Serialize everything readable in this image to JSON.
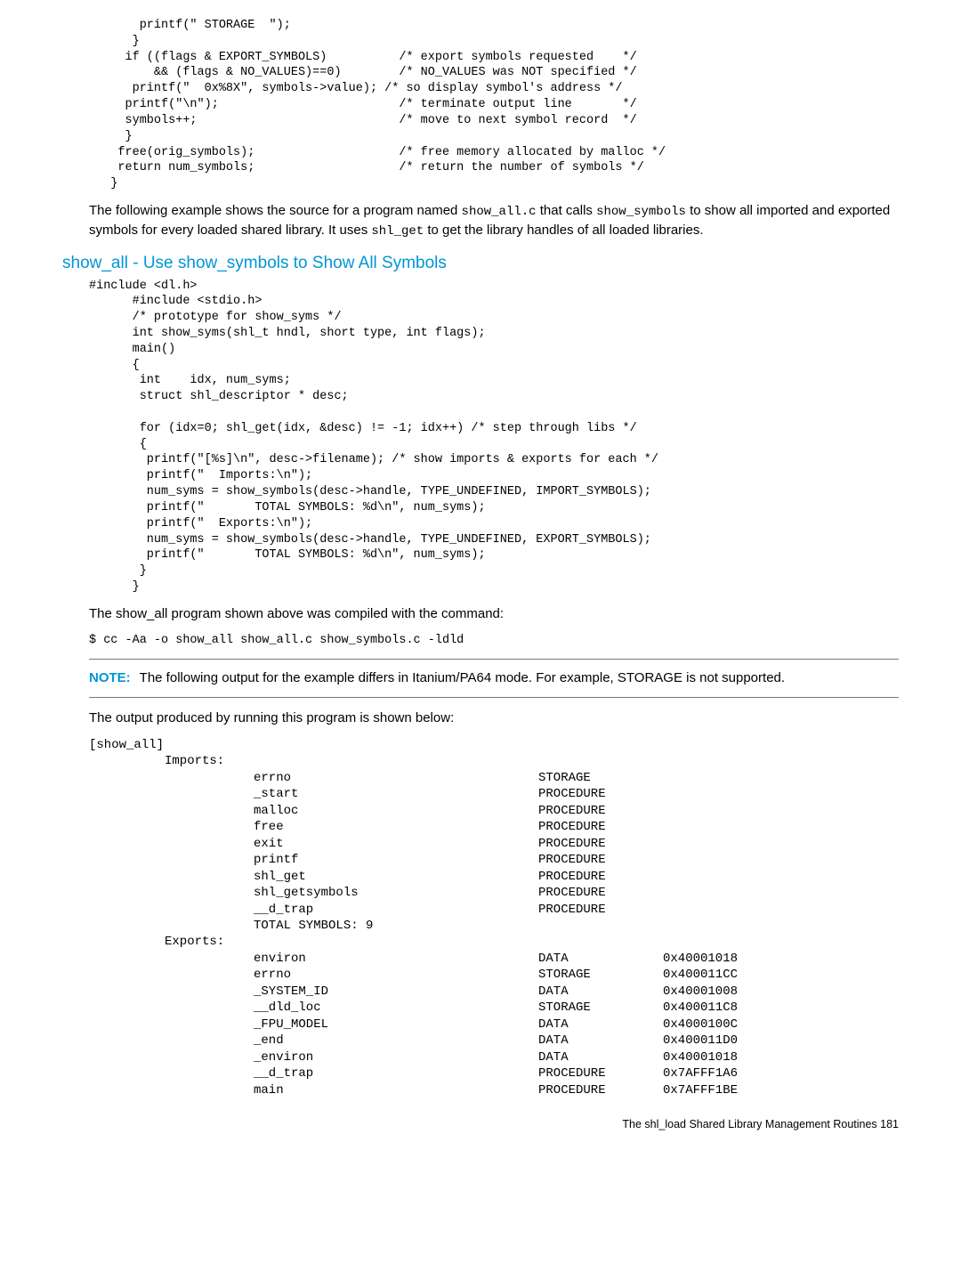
{
  "code1": "       printf(\" STORAGE  \");\n      }\n     if ((flags & EXPORT_SYMBOLS)          /* export symbols requested    */\n         && (flags & NO_VALUES)==0)        /* NO_VALUES was NOT specified */\n      printf(\"  0x%8X\", symbols->value); /* so display symbol's address */\n     printf(\"\\n\");                         /* terminate output line       */\n     symbols++;                            /* move to next symbol record  */\n     }\n    free(orig_symbols);                    /* free memory allocated by malloc */\n    return num_symbols;                    /* return the number of symbols */\n   }",
  "para1_a": "The following example shows the source for a program named ",
  "para1_m1": "show_all.c",
  "para1_b": " that calls ",
  "para1_m2": "show_symbols",
  "para1_c": " to show all imported and exported symbols for every loaded shared library. It uses ",
  "para1_m3": "shl_get",
  "para1_d": " to get the library handles of all loaded libraries.",
  "heading1": "show_all - Use show_symbols to Show All Symbols",
  "code2": "#include <dl.h>\n      #include <stdio.h>\n      /* prototype for show_syms */\n      int show_syms(shl_t hndl, short type, int flags);\n      main()\n      {\n       int    idx, num_syms;\n       struct shl_descriptor * desc;\n\n       for (idx=0; shl_get(idx, &desc) != -1; idx++) /* step through libs */\n       {\n        printf(\"[%s]\\n\", desc->filename); /* show imports & exports for each */\n        printf(\"  Imports:\\n\");\n        num_syms = show_symbols(desc->handle, TYPE_UNDEFINED, IMPORT_SYMBOLS);\n        printf(\"       TOTAL SYMBOLS: %d\\n\", num_syms);\n        printf(\"  Exports:\\n\");\n        num_syms = show_symbols(desc->handle, TYPE_UNDEFINED, EXPORT_SYMBOLS);\n        printf(\"       TOTAL SYMBOLS: %d\\n\", num_syms);\n       }\n      }",
  "para2": "The show_all program shown above was compiled with the command:",
  "cmd1": "$ cc -Aa -o show_all show_all.c show_symbols.c -ldld",
  "note_label": "NOTE:",
  "note_text": "The following output for the example differs in Itanium/PA64 mode. For example, STORAGE is not supported.",
  "para3": "The output produced by running this program is shown below:",
  "output_header": "[show_all]",
  "imports_label": "Imports:",
  "imports": [
    {
      "name": "errno",
      "type": "STORAGE"
    },
    {
      "name": "_start",
      "type": "PROCEDURE"
    },
    {
      "name": "malloc",
      "type": "PROCEDURE"
    },
    {
      "name": "free",
      "type": "PROCEDURE"
    },
    {
      "name": "exit",
      "type": "PROCEDURE"
    },
    {
      "name": "printf",
      "type": "PROCEDURE"
    },
    {
      "name": "shl_get",
      "type": "PROCEDURE"
    },
    {
      "name": "shl_getsymbols",
      "type": "PROCEDURE"
    },
    {
      "name": "__d_trap",
      "type": "PROCEDURE"
    }
  ],
  "total_symbols": "   TOTAL SYMBOLS: 9",
  "exports_label": "Exports:",
  "exports": [
    {
      "name": "environ",
      "type": "DATA",
      "addr": "0x40001018"
    },
    {
      "name": "errno",
      "type": "STORAGE",
      "addr": "0x400011CC"
    },
    {
      "name": "_SYSTEM_ID",
      "type": "DATA",
      "addr": "0x40001008"
    },
    {
      "name": "__dld_loc",
      "type": "STORAGE",
      "addr": "0x400011C8"
    },
    {
      "name": "_FPU_MODEL",
      "type": "DATA",
      "addr": "0x4000100C"
    },
    {
      "name": "_end",
      "type": "DATA",
      "addr": "0x400011D0"
    },
    {
      "name": "_environ",
      "type": "DATA",
      "addr": "0x40001018"
    },
    {
      "name": "__d_trap",
      "type": "PROCEDURE",
      "addr": "0x7AFFF1A6"
    },
    {
      "name": "main",
      "type": "PROCEDURE",
      "addr": "0x7AFFF1BE"
    }
  ],
  "footer": "The shl_load Shared Library Management Routines   181"
}
